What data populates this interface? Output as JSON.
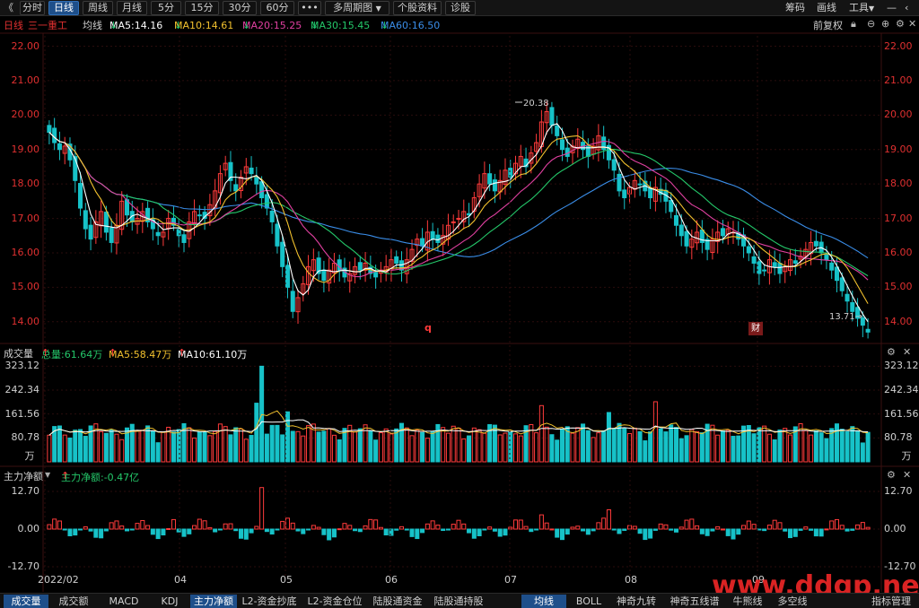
{
  "toolbar": {
    "back": "《",
    "periods": [
      "分时",
      "日线",
      "周线",
      "月线",
      "5分",
      "15分",
      "30分",
      "60分"
    ],
    "active": "日线",
    "more": "•••",
    "multi": "多周期图",
    "multi_arrow": "▼",
    "profile": "个股资料",
    "diagnose": "诊股",
    "right": [
      "筹码",
      "画线",
      "工具"
    ],
    "tools_arrow": "▼"
  },
  "ma_bar": {
    "period": "日线",
    "name": "三一重工",
    "avg": "均线",
    "ma5": "MA5:14.16",
    "ma10": "MA10:14.61",
    "ma20": "MA20:15.25",
    "ma30": "MA30:15.45",
    "ma60": "MA60:16.50",
    "arrow": "↓",
    "adjust": "前复权",
    "colors": {
      "ma5": "#ffffff",
      "ma10": "#f2c12e",
      "ma20": "#e040a0",
      "ma30": "#24c86a",
      "ma60": "#3a8de8"
    }
  },
  "vol_bar": {
    "label": "成交量",
    "total": "总量:61.64万",
    "ma5": "MA5:58.47万",
    "ma10": "MA10:61.10万",
    "arrow": "↑"
  },
  "flow_bar": {
    "label": "主力净额",
    "dropdown": "▼",
    "value": "主力净额:-0.47亿",
    "arrow": "↑"
  },
  "markers": {
    "high": "20.38",
    "low": "13.71",
    "low_arrow": "→",
    "q": "q",
    "cai": "财"
  },
  "bottom_tabs": [
    "成交量",
    "成交额",
    "MACD",
    "KDJ",
    "主力净额",
    "L2-资金抄底",
    "L2-资金仓位",
    "陆股通资金",
    "陆股通持股",
    "均线",
    "BOLL",
    "神奇九转",
    "神奇五线谱",
    "牛熊线",
    "多空线",
    "指标管理"
  ],
  "bottom_active": [
    "成交量",
    "主力净额",
    "均线"
  ],
  "watermark": "www.ddgp.net",
  "chart_data": [
    {
      "type": "candlestick",
      "title": "三一重工 日线",
      "x": [
        "2022/02",
        "04",
        "05",
        "06",
        "07",
        "08",
        "09"
      ],
      "y_ticks": [
        22.0,
        21.0,
        20.0,
        19.0,
        18.0,
        17.0,
        16.0,
        15.0,
        14.0
      ],
      "ylim": [
        13.5,
        22.3
      ],
      "high_label": 20.38,
      "low_label": 13.71,
      "closes": [
        19.5,
        19.2,
        19.0,
        19.1,
        18.7,
        18.1,
        17.3,
        16.7,
        16.4,
        16.9,
        17.2,
        16.6,
        16.3,
        16.8,
        17.5,
        17.1,
        16.9,
        17.0,
        17.2,
        16.9,
        16.7,
        16.5,
        16.6,
        17.0,
        16.8,
        16.5,
        16.3,
        16.9,
        17.2,
        17.1,
        17.0,
        17.4,
        17.8,
        18.3,
        18.6,
        18.1,
        17.8,
        18.2,
        18.5,
        18.3,
        18.0,
        17.6,
        17.3,
        16.9,
        16.2,
        15.6,
        15.0,
        14.3,
        14.7,
        15.1,
        15.6,
        15.8,
        15.4,
        15.2,
        15.5,
        15.7,
        15.5,
        15.3,
        15.4,
        15.6,
        15.5,
        15.7,
        15.4,
        15.3,
        15.5,
        15.6,
        15.8,
        15.7,
        15.5,
        15.8,
        16.1,
        16.4,
        16.2,
        16.6,
        16.4,
        16.3,
        16.5,
        16.8,
        16.9,
        17.0,
        17.2,
        17.1,
        17.6,
        18.0,
        18.3,
        18.0,
        17.8,
        18.1,
        18.4,
        18.2,
        18.6,
        18.8,
        18.5,
        18.9,
        19.2,
        19.8,
        20.1,
        19.7,
        19.4,
        19.0,
        18.8,
        19.1,
        19.3,
        19.0,
        18.8,
        19.1,
        19.4,
        19.0,
        18.7,
        18.4,
        17.8,
        17.6,
        17.9,
        18.1,
        18.0,
        17.8,
        17.6,
        17.9,
        17.7,
        17.5,
        17.2,
        16.8,
        16.5,
        16.2,
        16.4,
        16.6,
        16.3,
        16.1,
        16.4,
        16.6,
        16.5,
        16.7,
        16.6,
        16.4,
        16.2,
        16.0,
        15.7,
        15.4,
        15.5,
        15.8,
        15.6,
        15.4,
        15.6,
        15.8,
        15.7,
        15.9,
        16.1,
        16.3,
        16.2,
        16.0,
        15.8,
        15.5,
        15.2,
        14.9,
        14.6,
        14.3,
        14.1,
        13.9,
        13.7
      ],
      "ma": {
        "MA5": 14.16,
        "MA10": 14.61,
        "MA20": 15.25,
        "MA30": 15.45,
        "MA60": 16.5
      }
    },
    {
      "type": "bar",
      "title": "成交量",
      "y_ticks": [
        323.12,
        242.34,
        161.56,
        80.78
      ],
      "unit": "万",
      "total": 61.64,
      "ma5": 58.47,
      "ma10": 61.1
    },
    {
      "type": "bar",
      "title": "主力净额",
      "y_ticks": [
        12.7,
        0.0,
        -12.7
      ],
      "value": -0.47
    }
  ]
}
